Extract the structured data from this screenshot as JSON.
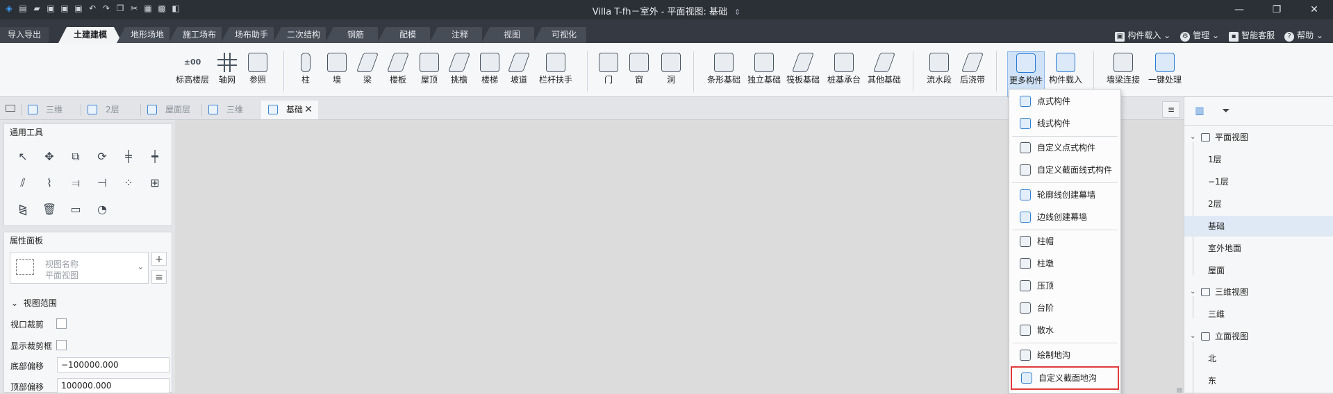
{
  "window": {
    "title": "Villa T-fh－室外 - 平面视图: 基础",
    "title_chevron": "⇕",
    "controls": {
      "minimize": "—",
      "maximize": "❐",
      "close": "✕"
    }
  },
  "quick_access": [
    "logo-icon",
    "new-file-icon",
    "open-folder-icon",
    "save-icon",
    "save-as-icon",
    "save-all-icon",
    "undo-icon",
    "redo-icon",
    "copy-icon",
    "cut-icon",
    "paste-icon",
    "format-icon",
    "cube-icon"
  ],
  "ribbon_tabs": [
    "导入导出",
    "土建建模",
    "地形场地",
    "施工场布",
    "场布助手",
    "二次结构",
    "钢筋",
    "配模",
    "注释",
    "视图",
    "可视化"
  ],
  "ribbon_active_tab": "土建建模",
  "top_right": {
    "component_load": "构件载入",
    "manage": "管理",
    "smart_service": "智能客服",
    "help": "帮助"
  },
  "ribbon": {
    "level_text_icon": "±00",
    "buttons": [
      "标高楼层",
      "轴网",
      "参照",
      "柱",
      "墙",
      "梁",
      "楼板",
      "屋顶",
      "挑檐",
      "楼梯",
      "坡道",
      "栏杆扶手",
      "门",
      "窗",
      "洞",
      "条形基础",
      "独立基础",
      "筏板基础",
      "桩基承台",
      "其他基础",
      "流水段",
      "后浇带",
      "更多构件",
      "构件载入",
      "墙梁连接",
      "一键处理"
    ],
    "active_button": "更多构件"
  },
  "view_tabs": [
    {
      "label": "三维",
      "active": false
    },
    {
      "label": "2层",
      "active": false
    },
    {
      "label": "屋面层",
      "active": false
    },
    {
      "label": "三维",
      "active": false
    },
    {
      "label": "基础",
      "active": true
    }
  ],
  "view_tab_close": "✕",
  "view_menu_icon": "≡",
  "tools_panel": {
    "title": "通用工具",
    "tools": [
      "select-icon",
      "move-icon",
      "copy-tool-icon",
      "rotate-icon",
      "trim-icon",
      "split-icon",
      "offset-icon",
      "stretch-icon",
      "align-icon",
      "extend-icon",
      "array-icon",
      "grid-array-icon",
      "mirror-icon",
      "delete-icon",
      "measure-icon",
      "angle-icon"
    ]
  },
  "properties_panel": {
    "title": "属性面板",
    "type_selector": {
      "line1": "视图名称",
      "line2": "平面视图"
    },
    "add_symbol": "+",
    "edit_symbol": "≡",
    "section": "视图范围",
    "fields": [
      {
        "label": "视口裁剪",
        "type": "checkbox",
        "checked": false
      },
      {
        "label": "显示裁剪框",
        "type": "checkbox",
        "checked": false
      },
      {
        "label": "底部偏移",
        "type": "text",
        "value": "−100000.000"
      },
      {
        "label": "顶部偏移",
        "type": "text",
        "value": "100000.000"
      }
    ]
  },
  "more_components_menu": {
    "items": [
      "点式构件",
      "线式构件",
      "自定义点式构件",
      "自定义截面线式构件",
      "轮廓线创建幕墙",
      "边线创建幕墙",
      "柱帽",
      "柱墩",
      "压顶",
      "台阶",
      "散水",
      "绘制地沟",
      "自定义截面地沟"
    ],
    "highlighted": "自定义截面地沟"
  },
  "project_browser": {
    "nodes": [
      {
        "label": "平面视图",
        "level": 0,
        "expanded": true
      },
      {
        "label": "1层",
        "level": 1
      },
      {
        "label": "−1层",
        "level": 1
      },
      {
        "label": "2层",
        "level": 1
      },
      {
        "label": "基础",
        "level": 1,
        "selected": true
      },
      {
        "label": "室外地面",
        "level": 1
      },
      {
        "label": "屋面",
        "level": 1
      },
      {
        "label": "三维视图",
        "level": 0,
        "expanded": true
      },
      {
        "label": "三维",
        "level": 1
      },
      {
        "label": "立面视图",
        "level": 0,
        "expanded": true
      },
      {
        "label": "北",
        "level": 1
      },
      {
        "label": "东",
        "level": 1
      }
    ]
  },
  "colors": {
    "title_bg": "#2b2f36",
    "tab_bg": "#353a42",
    "accent": "#2a7bd6",
    "highlight_border": "#e03a3a"
  }
}
